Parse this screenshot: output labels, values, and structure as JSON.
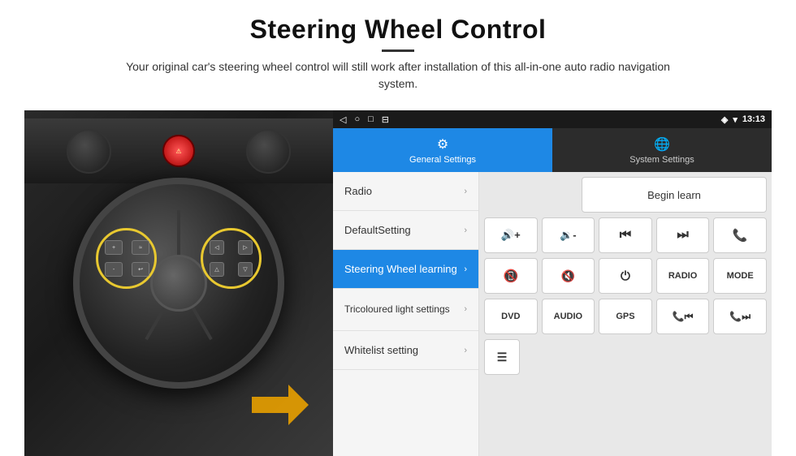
{
  "header": {
    "title": "Steering Wheel Control",
    "divider": true,
    "subtitle": "Your original car's steering wheel control will still work after installation of this all-in-one auto radio navigation system."
  },
  "status_bar": {
    "nav_icons": [
      "◁",
      "○",
      "□",
      "⊟"
    ],
    "right": {
      "location_icon": "◈",
      "wifi_icon": "▾",
      "time": "13:13"
    }
  },
  "tabs": [
    {
      "id": "general",
      "label": "General Settings",
      "icon": "⚙",
      "active": true
    },
    {
      "id": "system",
      "label": "System Settings",
      "icon": "🌐",
      "active": false
    }
  ],
  "menu": {
    "items": [
      {
        "id": "radio",
        "label": "Radio",
        "active": false
      },
      {
        "id": "default-setting",
        "label": "DefaultSetting",
        "active": false
      },
      {
        "id": "steering-wheel",
        "label": "Steering Wheel learning",
        "active": true
      },
      {
        "id": "tricoloured",
        "label": "Tricoloured light settings",
        "active": false
      },
      {
        "id": "whitelist",
        "label": "Whitelist setting",
        "active": false
      }
    ]
  },
  "controls": {
    "begin_learn_label": "Begin learn",
    "row1": [
      {
        "id": "vol-up",
        "icon": "🔊+",
        "label": "Vol+"
      },
      {
        "id": "vol-dn",
        "icon": "🔉-",
        "label": "Vol-"
      },
      {
        "id": "prev-track",
        "icon": "⏮",
        "label": "Prev"
      },
      {
        "id": "next-track",
        "icon": "⏭",
        "label": "Next"
      },
      {
        "id": "phone",
        "icon": "📞",
        "label": "Call"
      }
    ],
    "row2": [
      {
        "id": "hang-up",
        "icon": "📵",
        "label": "HangUp"
      },
      {
        "id": "mute",
        "icon": "🔇",
        "label": "Mute"
      },
      {
        "id": "power",
        "icon": "⏻",
        "label": "Power"
      },
      {
        "id": "radio-btn",
        "icon": "RADIO",
        "label": "Radio"
      },
      {
        "id": "mode-btn",
        "icon": "MODE",
        "label": "Mode"
      }
    ],
    "row3": [
      {
        "id": "dvd-btn",
        "icon": "DVD",
        "label": "DVD"
      },
      {
        "id": "audio-btn",
        "icon": "AUDIO",
        "label": "Audio"
      },
      {
        "id": "gps-btn",
        "icon": "GPS",
        "label": "GPS"
      },
      {
        "id": "tel-prev",
        "icon": "📞⏮",
        "label": "TelPrev"
      },
      {
        "id": "tel-next",
        "icon": "📞⏭",
        "label": "TelNext"
      }
    ],
    "row4": [
      {
        "id": "list-icon",
        "icon": "☰",
        "label": "List"
      }
    ]
  }
}
